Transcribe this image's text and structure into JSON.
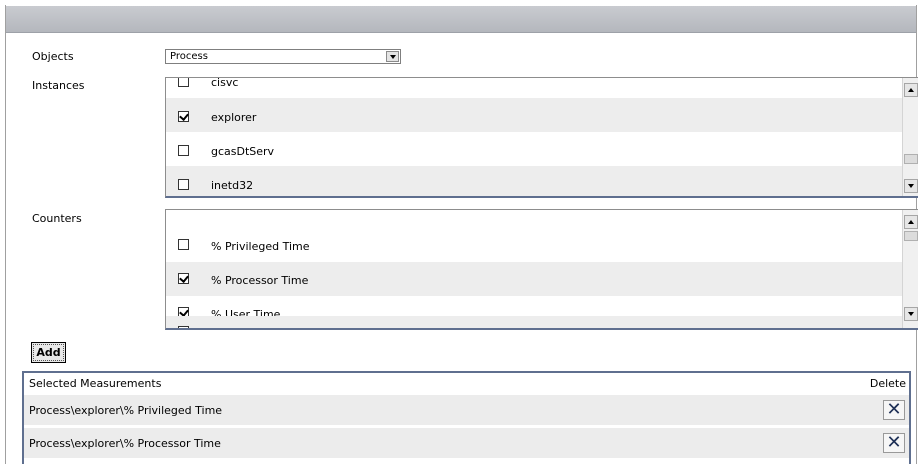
{
  "labels": {
    "objects": "Objects",
    "instances": "Instances",
    "counters": "Counters"
  },
  "objects_select": {
    "value": "Process"
  },
  "instances": [
    {
      "label": "cisvc",
      "checked": false
    },
    {
      "label": "explorer",
      "checked": true
    },
    {
      "label": "gcasDtServ",
      "checked": false
    },
    {
      "label": "inetd32",
      "checked": false
    }
  ],
  "counters": [
    {
      "label": "% Privileged Time",
      "checked": false
    },
    {
      "label": "% Processor Time",
      "checked": true
    },
    {
      "label": "% User Time",
      "checked": true
    }
  ],
  "add_button": "Add",
  "selected": {
    "header": "Selected Measurements",
    "delete_header": "Delete",
    "rows": [
      {
        "text": "Process\\explorer\\% Privileged Time",
        "delete": "✕"
      },
      {
        "text": "Process\\explorer\\% Processor Time",
        "delete": "✕"
      }
    ]
  }
}
